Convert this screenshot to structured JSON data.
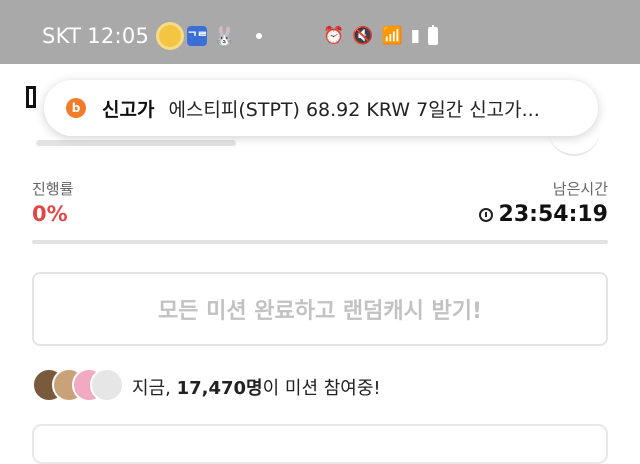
{
  "status_bar": {
    "carrier": "SKT",
    "time": "12:05",
    "app_badge": "ᄀᄅ",
    "icons": [
      "weather-sun-icon",
      "app-badge-icon",
      "bunny-icon",
      "dot-icon",
      "alarm-icon",
      "mute-icon",
      "wifi-icon",
      "signal-icon",
      "battery-icon"
    ]
  },
  "toast": {
    "icon_letter": "b",
    "title": "신고가",
    "body": "에스티피(STPT) 68.92 KRW 7일간 신고가..."
  },
  "progress": {
    "label": "진행률",
    "value_text": "0%",
    "value": 0,
    "remaining_label": "남은시간",
    "remaining_time": "23:54:19"
  },
  "cta": {
    "label": "모든 미션 완료하고 랜덤캐시 받기!"
  },
  "participants": {
    "prefix": "지금, ",
    "count": "17,470명",
    "suffix": "이 미션 참여중!"
  },
  "colors": {
    "accent": "#e04848",
    "status_bar_bg": "#a9a9a9",
    "cta_text": "#c2c2c2"
  }
}
